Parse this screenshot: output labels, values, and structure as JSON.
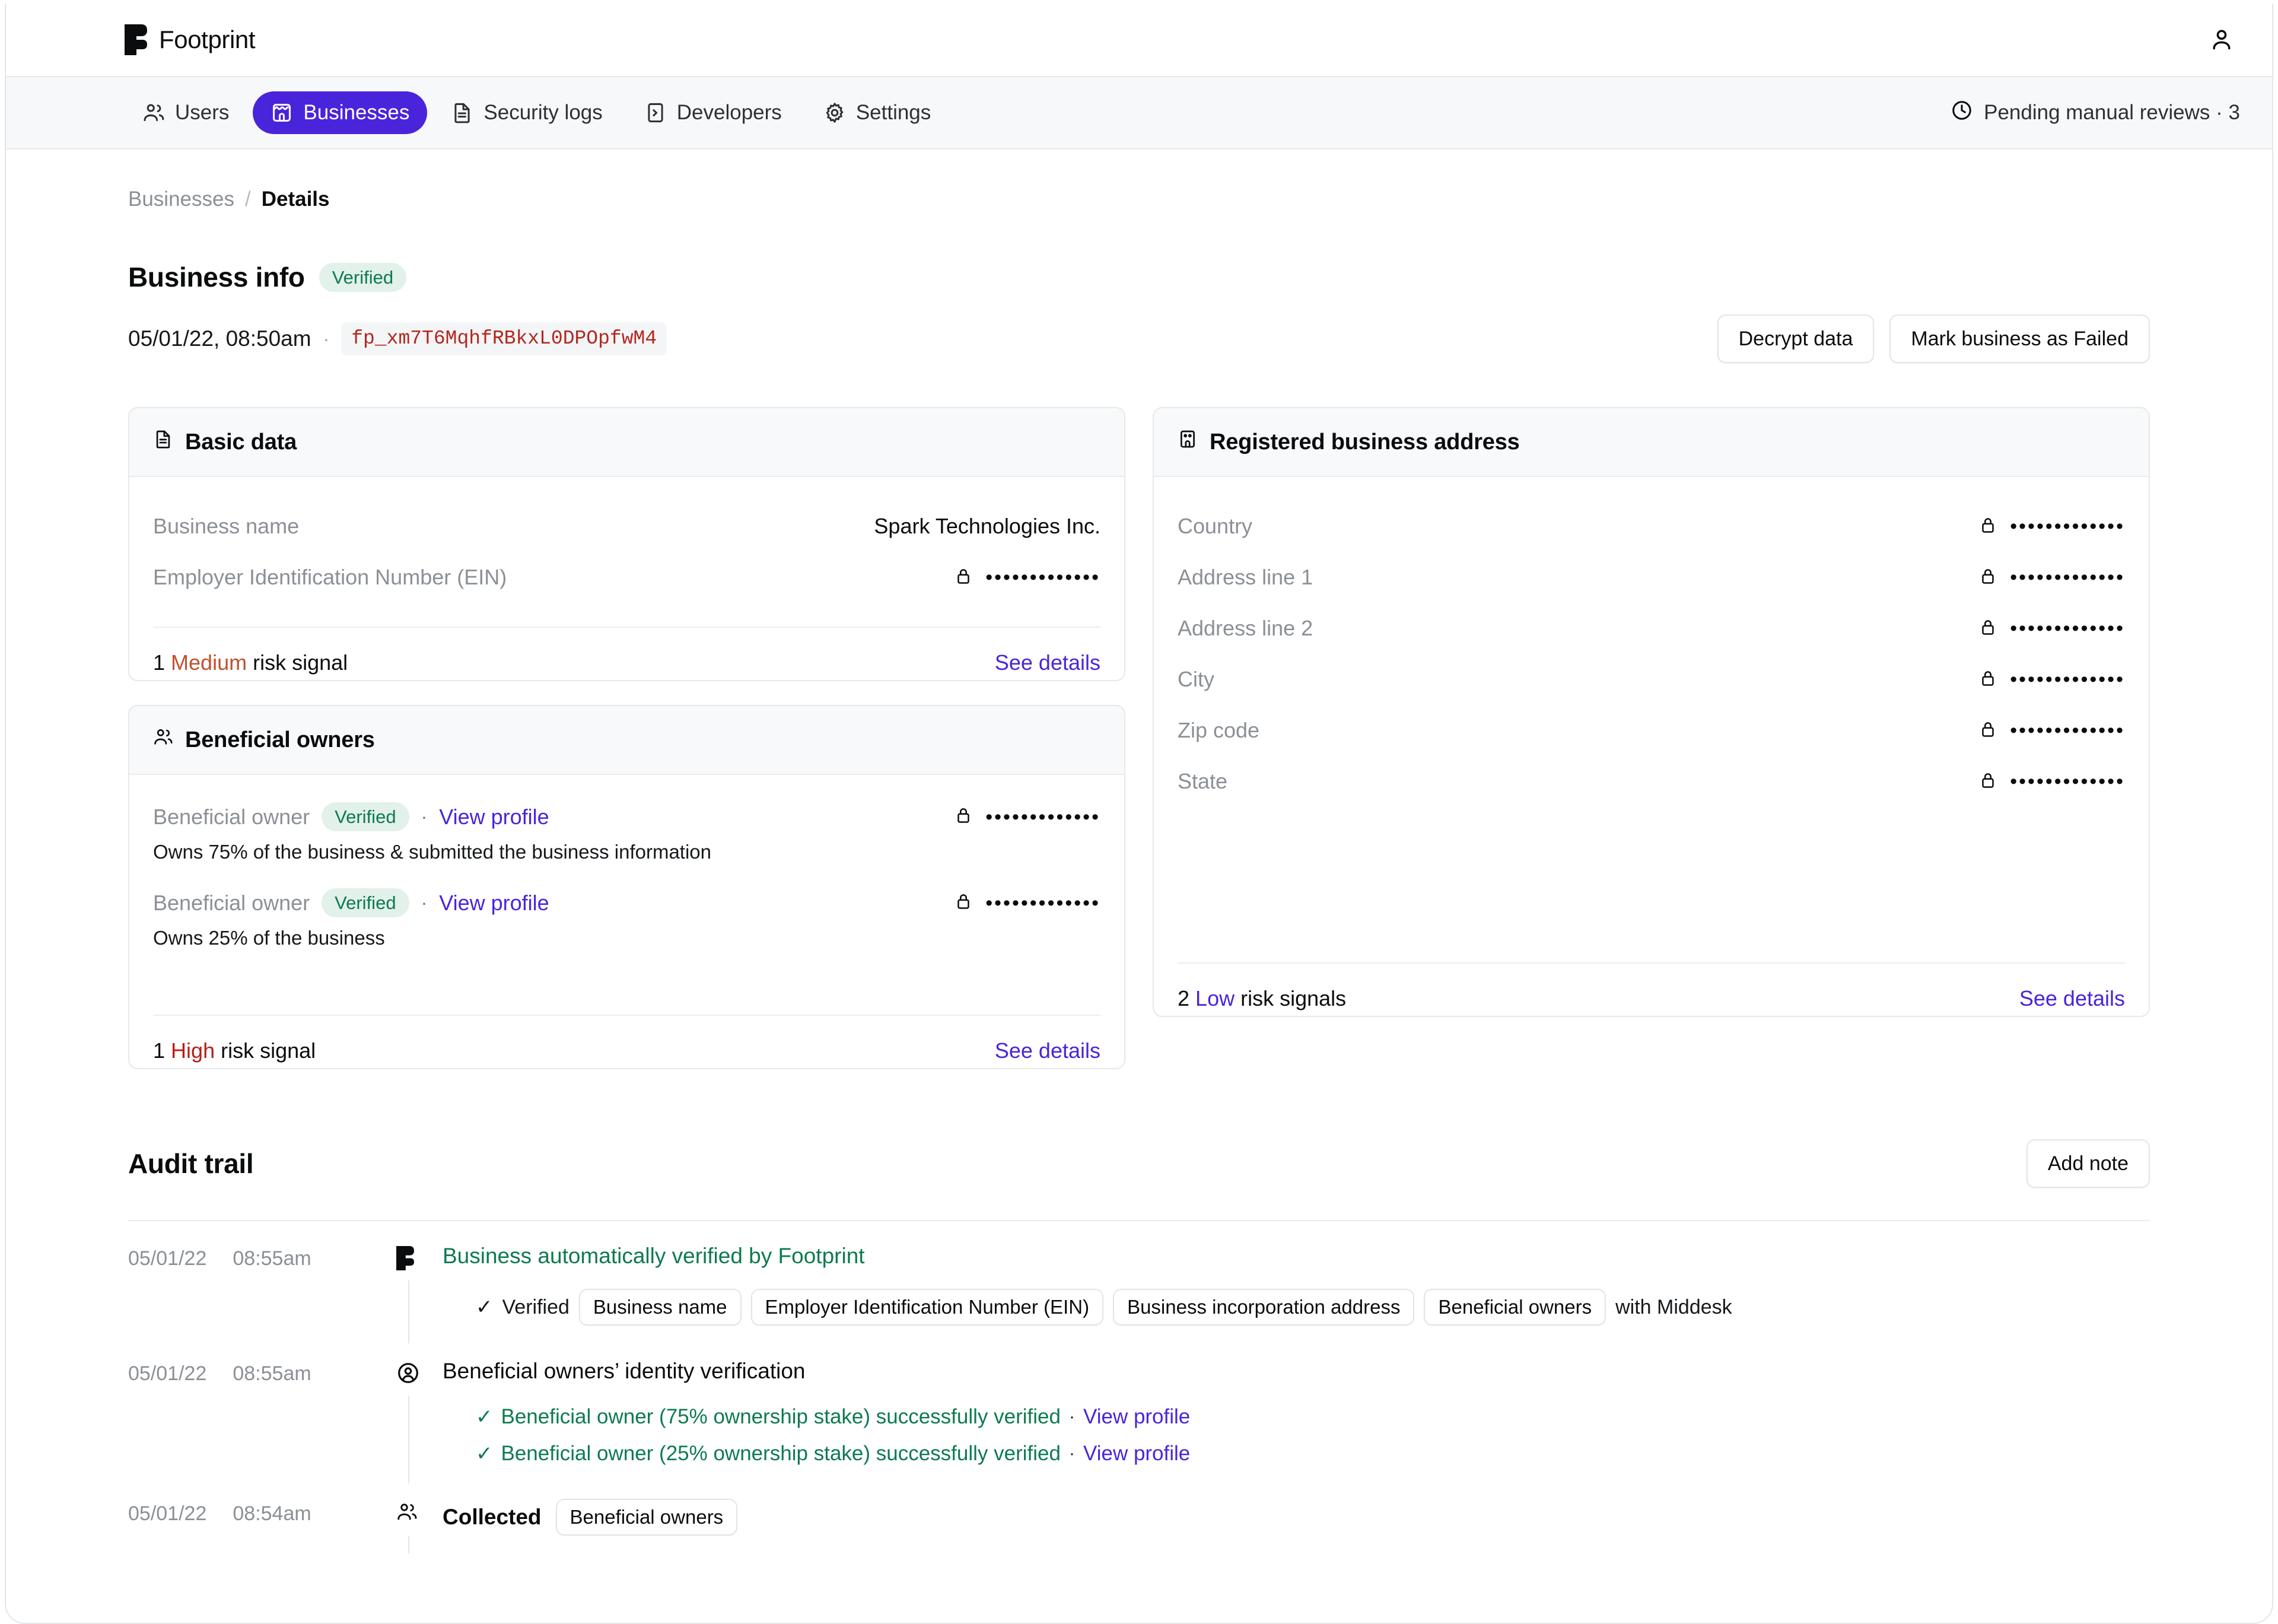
{
  "brand": {
    "name": "Footprint",
    "logo_icon": "footprint-logo-icon"
  },
  "topbar": {
    "account_icon": "user-account-icon"
  },
  "nav": {
    "items": [
      {
        "label": "Users",
        "icon": "users-icon",
        "active": false
      },
      {
        "label": "Businesses",
        "icon": "storefront-icon",
        "active": true
      },
      {
        "label": "Security logs",
        "icon": "file-text-icon",
        "active": false
      },
      {
        "label": "Developers",
        "icon": "terminal-icon",
        "active": false
      },
      {
        "label": "Settings",
        "icon": "gear-icon",
        "active": false
      }
    ],
    "pending": {
      "label": "Pending manual reviews · 3",
      "icon": "clock-icon"
    }
  },
  "breadcrumb": {
    "parent": "Businesses",
    "separator": "/",
    "current": "Details"
  },
  "business_info": {
    "title": "Business info",
    "status_badge": "Verified",
    "timestamp": "05/01/22, 08:50am",
    "separator": "·",
    "footprint_id": "fp_xm7T6MqhfRBkxL0DPOpfwM4",
    "actions": {
      "decrypt": "Decrypt data",
      "mark_failed": "Mark business as Failed"
    }
  },
  "basic_data": {
    "title": "Basic data",
    "icon": "file-text-icon",
    "rows": [
      {
        "label": "Business name",
        "value": "Spark Technologies Inc.",
        "encrypted": false
      },
      {
        "label": "Employer Identification Number (EIN)",
        "value": "•••••••••••••",
        "encrypted": true
      }
    ],
    "risk": {
      "count": "1",
      "level": "Medium",
      "suffix": "risk signal",
      "color": "#bf512e"
    },
    "see_details": "See details"
  },
  "beneficial_owners": {
    "title": "Beneficial owners",
    "icon": "users-icon",
    "owners": [
      {
        "label": "Beneficial owner",
        "badge": "Verified",
        "separator": "·",
        "link": "View profile",
        "value": "•••••••••••••",
        "note": "Owns 75% of the business & submitted the business information"
      },
      {
        "label": "Beneficial owner",
        "badge": "Verified",
        "separator": "·",
        "link": "View profile",
        "value": "•••••••••••••",
        "note": "Owns 25% of the business"
      }
    ],
    "risk": {
      "count": "1",
      "level": "High",
      "suffix": "risk signal",
      "color": "#b81d16"
    },
    "see_details": "See details"
  },
  "registered_address": {
    "title": "Registered business address",
    "icon": "building-icon",
    "rows": [
      {
        "label": "Country",
        "value": "•••••••••••••"
      },
      {
        "label": "Address line 1",
        "value": "•••••••••••••"
      },
      {
        "label": "Address line 2",
        "value": "•••••••••••••"
      },
      {
        "label": "City",
        "value": "•••••••••••••"
      },
      {
        "label": "Zip code",
        "value": "•••••••••••••"
      },
      {
        "label": "State",
        "value": "•••••••••••••"
      }
    ],
    "risk": {
      "count": "2",
      "level": "Low",
      "suffix": "risk signals",
      "color": "#4a24db"
    },
    "see_details": "See details"
  },
  "audit_trail": {
    "title": "Audit trail",
    "add_note": "Add note",
    "entries": [
      {
        "date": "05/01/22",
        "time": "08:55am",
        "icon": "footprint-logo-icon",
        "headline": "Business automatically verified by Footprint",
        "check": "✓",
        "verified_label": "Verified",
        "tags": [
          "Business name",
          "Employer Identification Number (EIN)",
          "Business incorporation address",
          "Beneficial owners"
        ],
        "trailing_text": "with Middesk"
      },
      {
        "date": "05/01/22",
        "time": "08:55am",
        "icon": "user-circle-icon",
        "headline": "Beneficial owners’ identity verification",
        "sublines": [
          {
            "check": "✓",
            "text": "Beneficial owner (75% ownership stake) successfully verified",
            "separator": "·",
            "link": "View profile"
          },
          {
            "check": "✓",
            "text": "Beneficial owner (25% ownership stake) successfully verified",
            "separator": "·",
            "link": "View profile"
          }
        ]
      },
      {
        "date": "05/01/22",
        "time": "08:54am",
        "icon": "users-icon",
        "headline": "Collected",
        "tags": [
          "Beneficial owners"
        ]
      }
    ]
  },
  "colors": {
    "accent": "#4a24db",
    "green": "#0d7a50",
    "green_bg": "#e2f1e9",
    "red": "#b81d16",
    "orange": "#bf512e",
    "token_red": "#b3261e",
    "muted": "#8b9096"
  }
}
